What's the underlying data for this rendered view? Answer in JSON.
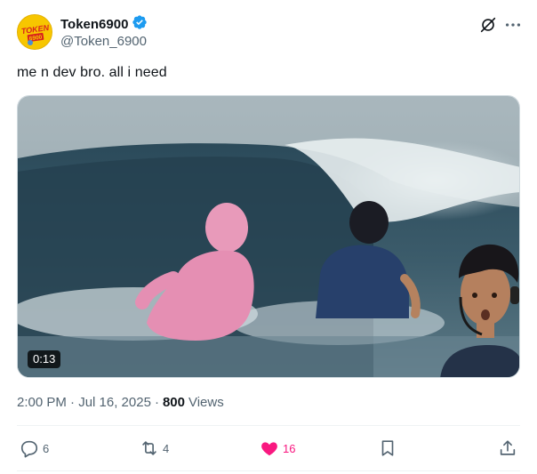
{
  "author": {
    "display_name": "Token6900",
    "handle": "@Token_6900",
    "verified": true,
    "avatar_text": "TOKEN 6900"
  },
  "tweet": {
    "text": "me n dev bro. all i need",
    "video_duration": "0:13",
    "timestamp": "2:00 PM · Jul 16, 2025",
    "separator": "·",
    "views_count": "800",
    "views_label": "Views"
  },
  "actions": {
    "reply_count": "6",
    "repost_count": "4",
    "like_count": "16",
    "liked": true
  },
  "icons": {
    "verified": "verified-badge-icon",
    "grok": "grok-icon",
    "more": "more-options-icon",
    "reply": "reply-icon",
    "repost": "repost-icon",
    "like": "heart-icon",
    "bookmark": "bookmark-icon",
    "share": "share-icon"
  },
  "colors": {
    "accent_blue": "#1d9bf0",
    "like_pink": "#f91880",
    "text_primary": "#0f1419",
    "text_secondary": "#536471"
  }
}
